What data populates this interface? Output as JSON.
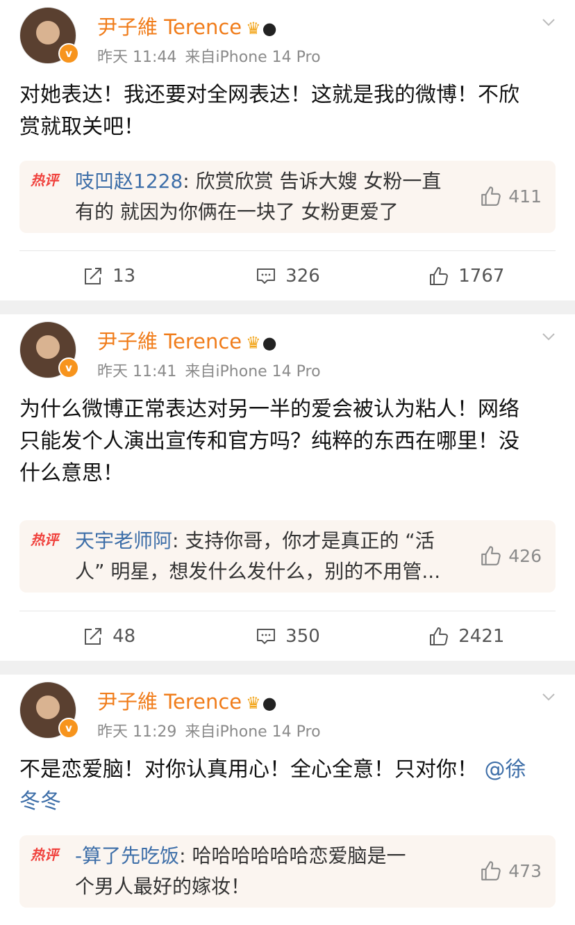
{
  "posts": [
    {
      "author": "尹子維 Terence",
      "time": "昨天 11:44",
      "source": "来自iPhone 14 Pro",
      "text_lines": [
        "对她表达！我还要对全网表达！这就是我的微博！不欣",
        "赏就取关吧！"
      ],
      "mention": "",
      "hot_comment": {
        "tag": "热评",
        "user": "吱凹赵1228",
        "text_lines": [
          ": 欣赏欣赏 告诉大嫂 女粉一直",
          "有的 就因为你俩在一块了 女粉更爱了"
        ],
        "likes": "411"
      },
      "reposts": "13",
      "comments": "326",
      "likes": "1767"
    },
    {
      "author": "尹子維 Terence",
      "time": "昨天 11:41",
      "source": "来自iPhone 14 Pro",
      "text_lines": [
        "为什么微博正常表达对另一半的爱会被认为粘人！网络",
        "只能发个人演出宣传和官方吗？纯粹的东西在哪里！没",
        "什么意思！"
      ],
      "mention": "",
      "hot_comment": {
        "tag": "热评",
        "user": "天宇老师阿",
        "text_lines": [
          ": 支持你哥，你才是真正的 “活",
          "人” 明星，想发什么发什么，别的不用管..."
        ],
        "likes": "426"
      },
      "reposts": "48",
      "comments": "350",
      "likes": "2421"
    },
    {
      "author": "尹子維 Terence",
      "time": "昨天 11:29",
      "source": "来自iPhone 14 Pro",
      "text_lines": [
        "不是恋爱脑！对你认真用心！全心全意！只对你！",
        "冬冬"
      ],
      "mention": "@徐",
      "hot_comment": {
        "tag": "热评",
        "user": "-算了先吃饭",
        "text_lines": [
          ": 哈哈哈哈哈哈恋爱脑是一",
          "个男人最好的嫁妆！"
        ],
        "likes": "473"
      }
    }
  ],
  "icons": {
    "repost": "repost-icon",
    "comment": "comment-icon",
    "like": "thumbs-up-icon",
    "menu": "chevron-down-icon",
    "verified": "verified-v-badge-icon",
    "crown": "crown-icon",
    "panda": "panda-icon"
  },
  "colors": {
    "author": "#f07c1a",
    "mention": "#3d6ea8",
    "hot_tag": "#f0413c",
    "hot_bg": "#fbf5f0",
    "separator": "#f0f0f0"
  }
}
